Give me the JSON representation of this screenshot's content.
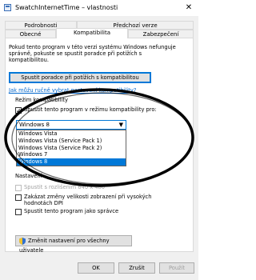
{
  "window": {
    "title": "SwatchInternetTime – vlastnosti",
    "close_glyph": "✕"
  },
  "tabs": {
    "row1": [
      "Podrobnosti",
      "Předchozí verze"
    ],
    "row2": [
      "Obecné",
      "Kompatibilita",
      "Zabezpečení"
    ],
    "active": "Kompatibilita"
  },
  "compat": {
    "intro": [
      "Pokud tento program v této verzi systému Windows nefunguje",
      "správně, pokuste se spustit poradce při potížích s",
      "kompatibilitou."
    ],
    "troubleshoot_button": "Spustit poradce při potížích s kompatibilitou",
    "manual_link": "Jak můžu ručně vybrat nastavení kompatibility?",
    "group_title": "Režim kompatibility",
    "run_in_compat_label": "Spustit tento program v režimu kompatibility pro:",
    "run_in_compat_checked": true,
    "selected_os": "Windows 8",
    "os_options": [
      "Windows Vista",
      "Windows Vista (Service Pack 1)",
      "Windows Vista (Service Pack 2)",
      "Windows 7",
      "Windows 8"
    ],
    "settings_title": "Nastavení",
    "resolution_label": "Spustit s rozlišením 640 x 480",
    "dpi_label": [
      "Zakázat změny velikosti zobrazení při vysokých",
      "hodnotách DPI"
    ],
    "admin_label": "Spustit tento program jako správce",
    "change_all_button": "Změnit nastavení pro všechny uživatele"
  },
  "footer": {
    "ok": "OK",
    "cancel": "Zrušit",
    "apply": "Použít"
  },
  "colors": {
    "accent": "#0078d7",
    "annotation": "#000000",
    "link": "#0066cc"
  }
}
